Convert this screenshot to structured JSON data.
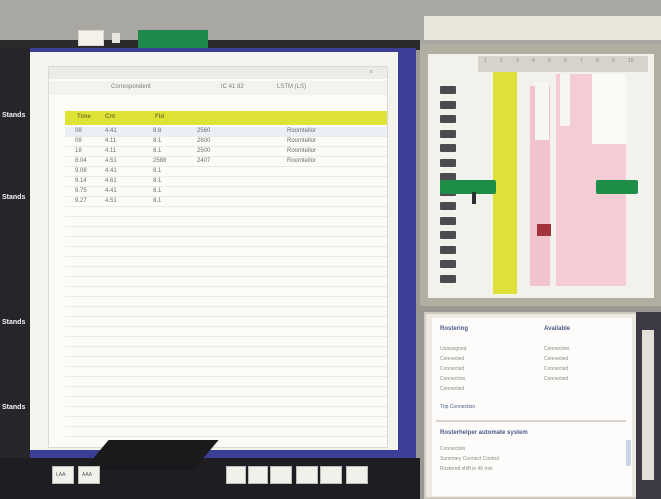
{
  "channels": [
    "Stands",
    "Stands",
    "Stands",
    "Stands"
  ],
  "log_window": {
    "toolbar": [
      "Correspondent",
      "IC 41 82",
      "LSTM (LS)"
    ],
    "close_glyph": "×",
    "header": [
      "Time",
      "Cnt",
      "Fld"
    ],
    "rows": [
      [
        "08",
        "4.41",
        "8.8",
        "2560",
        "Roomtellor"
      ],
      [
        "08",
        "4.11",
        "8.1",
        "2600",
        "Roomtellor"
      ],
      [
        "18",
        "4.11",
        "8.1",
        "2500",
        "Roomtellor"
      ],
      [
        "8.04",
        "4.51",
        "2588",
        "2407",
        "Roomtellor"
      ],
      [
        "9.08",
        "4.41",
        "8.1",
        "",
        ""
      ],
      [
        "9.14",
        "4.61",
        "8.1",
        "",
        ""
      ],
      [
        "9.75",
        "4.41",
        "8.1",
        "",
        ""
      ],
      [
        "9.27",
        "4.51",
        "8.1",
        "",
        ""
      ]
    ]
  },
  "bottom_boxes": [
    "LAA",
    "AAA",
    "",
    "",
    "",
    "",
    "",
    ""
  ],
  "grid": {
    "columns": [
      "1",
      "2",
      "3",
      "4",
      "5",
      "6",
      "7",
      "8",
      "9",
      "10"
    ],
    "rows": 14
  },
  "info_panel": {
    "title_left": "Rostering",
    "title_right": "Available",
    "left_lines": [
      "Unassigned",
      "Connected",
      "Connected",
      "Connection",
      "Connected"
    ],
    "right_lines": [
      "Connection",
      "Connected",
      "Connected",
      "Connected"
    ],
    "left_footer": "Trip   Connection",
    "section_title": "Rosterhelper automate system",
    "section_lines": [
      "Connection",
      "Summary   Connect   Control",
      "Rostered shift in 40 min"
    ]
  },
  "colors": {
    "accent_yellow": "#dfe336",
    "accent_green": "#1e8d47",
    "frame_blue": "#3d3f96",
    "marker_red": "#a2333b"
  }
}
